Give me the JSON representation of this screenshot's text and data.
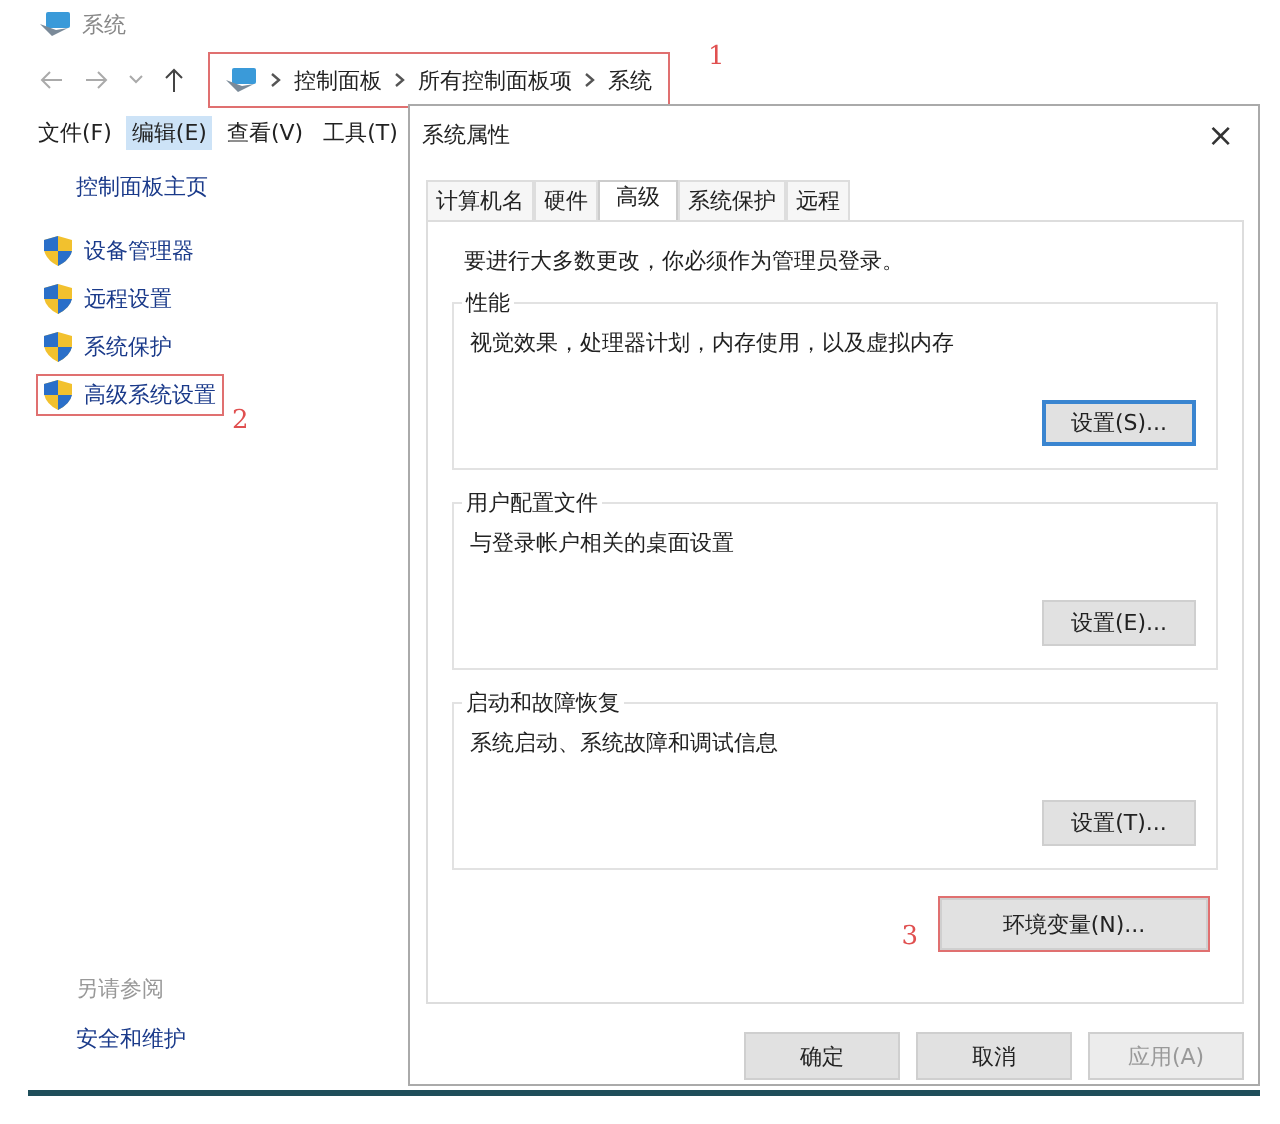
{
  "explorer": {
    "title": "系统",
    "breadcrumb": {
      "items": [
        "控制面板",
        "所有控制面板项",
        "系统"
      ],
      "highlighted": true,
      "annotation": "1"
    },
    "menu": [
      {
        "label": "文件(F)",
        "selected": false
      },
      {
        "label": "编辑(E)",
        "selected": true
      },
      {
        "label": "查看(V)",
        "selected": false
      },
      {
        "label": "工具(T)",
        "selected": false
      }
    ],
    "sidebar": {
      "home": "控制面板主页",
      "items": [
        {
          "label": "设备管理器",
          "highlighted": false
        },
        {
          "label": "远程设置",
          "highlighted": false
        },
        {
          "label": "系统保护",
          "highlighted": false
        },
        {
          "label": "高级系统设置",
          "highlighted": true,
          "annotation": "2"
        }
      ]
    },
    "see_also": {
      "heading": "另请参阅",
      "links": [
        "安全和维护"
      ]
    }
  },
  "dialog": {
    "title": "系统属性",
    "close": "×",
    "tabs": [
      {
        "label": "计算机名",
        "selected": false
      },
      {
        "label": "硬件",
        "selected": false
      },
      {
        "label": "高级",
        "selected": true
      },
      {
        "label": "系统保护",
        "selected": false
      },
      {
        "label": "远程",
        "selected": false
      }
    ],
    "notice": "要进行大多数更改，你必须作为管理员登录。",
    "groups": [
      {
        "title": "性能",
        "description": "视觉效果，处理器计划，内存使用，以及虚拟内存",
        "button": {
          "label": "设置(S)...",
          "focused": true
        }
      },
      {
        "title": "用户配置文件",
        "description": "与登录帐户相关的桌面设置",
        "button": {
          "label": "设置(E)...",
          "focused": false
        }
      },
      {
        "title": "启动和故障恢复",
        "description": "系统启动、系统故障和调试信息",
        "button": {
          "label": "设置(T)...",
          "focused": false
        }
      }
    ],
    "env_button": {
      "label": "环境变量(N)...",
      "highlighted": true,
      "annotation": "3"
    },
    "footer": [
      {
        "label": "确定",
        "disabled": false
      },
      {
        "label": "取消",
        "disabled": false
      },
      {
        "label": "应用(A)",
        "disabled": true
      }
    ]
  }
}
